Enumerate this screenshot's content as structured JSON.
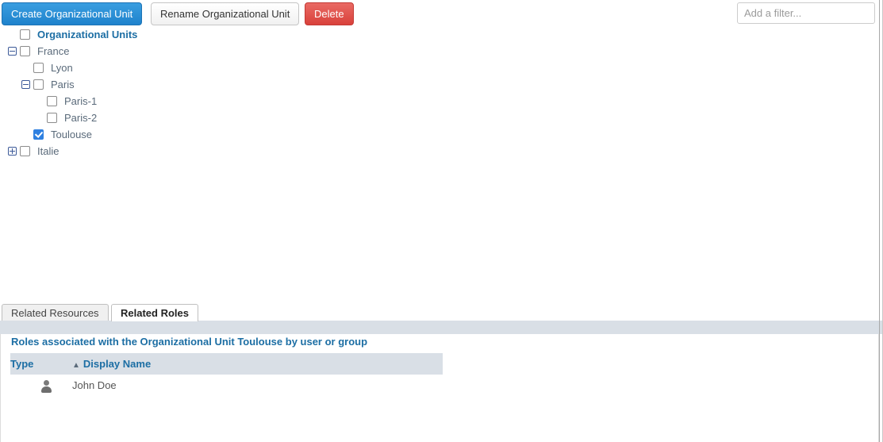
{
  "toolbar": {
    "create_label": "Create Organizational Unit",
    "rename_label": "Rename Organizational Unit",
    "delete_label": "Delete",
    "filter_placeholder": "Add a filter...",
    "filter_value": ""
  },
  "colors": {
    "primary_button": "#1f82cc",
    "danger_button": "#d9413b",
    "accent_text": "#1c6ea4",
    "header_band": "#d9dfe6",
    "checked_checkbox": "#2f80e0",
    "expander_border": "#3b5998"
  },
  "tree": {
    "nodes": [
      {
        "label": "Organizational Units",
        "depth": 0,
        "expander": "none",
        "checked": false,
        "root": true
      },
      {
        "label": "France",
        "depth": 0,
        "expander": "collapse",
        "checked": false,
        "root": false
      },
      {
        "label": "Lyon",
        "depth": 1,
        "expander": "none",
        "checked": false,
        "root": false
      },
      {
        "label": "Paris",
        "depth": 1,
        "expander": "collapse",
        "checked": false,
        "root": false
      },
      {
        "label": "Paris-1",
        "depth": 2,
        "expander": "none",
        "checked": false,
        "root": false
      },
      {
        "label": "Paris-2",
        "depth": 2,
        "expander": "none",
        "checked": false,
        "root": false
      },
      {
        "label": "Toulouse",
        "depth": 1,
        "expander": "none",
        "checked": true,
        "root": false
      },
      {
        "label": "Italie",
        "depth": 0,
        "expander": "expand",
        "checked": false,
        "root": false
      }
    ]
  },
  "bottom_panel": {
    "tabs": [
      {
        "label": "Related Resources",
        "active": false
      },
      {
        "label": "Related Roles",
        "active": true
      }
    ],
    "heading": "Roles associated with the Organizational Unit Toulouse by user or group",
    "table": {
      "columns": [
        "Type",
        "Display Name"
      ],
      "sort_column": "Display Name",
      "sort_direction": "asc",
      "sort_arrow_glyph": "▲",
      "rows": [
        {
          "type_icon": "user-icon",
          "display_name": "John Doe"
        }
      ]
    }
  }
}
